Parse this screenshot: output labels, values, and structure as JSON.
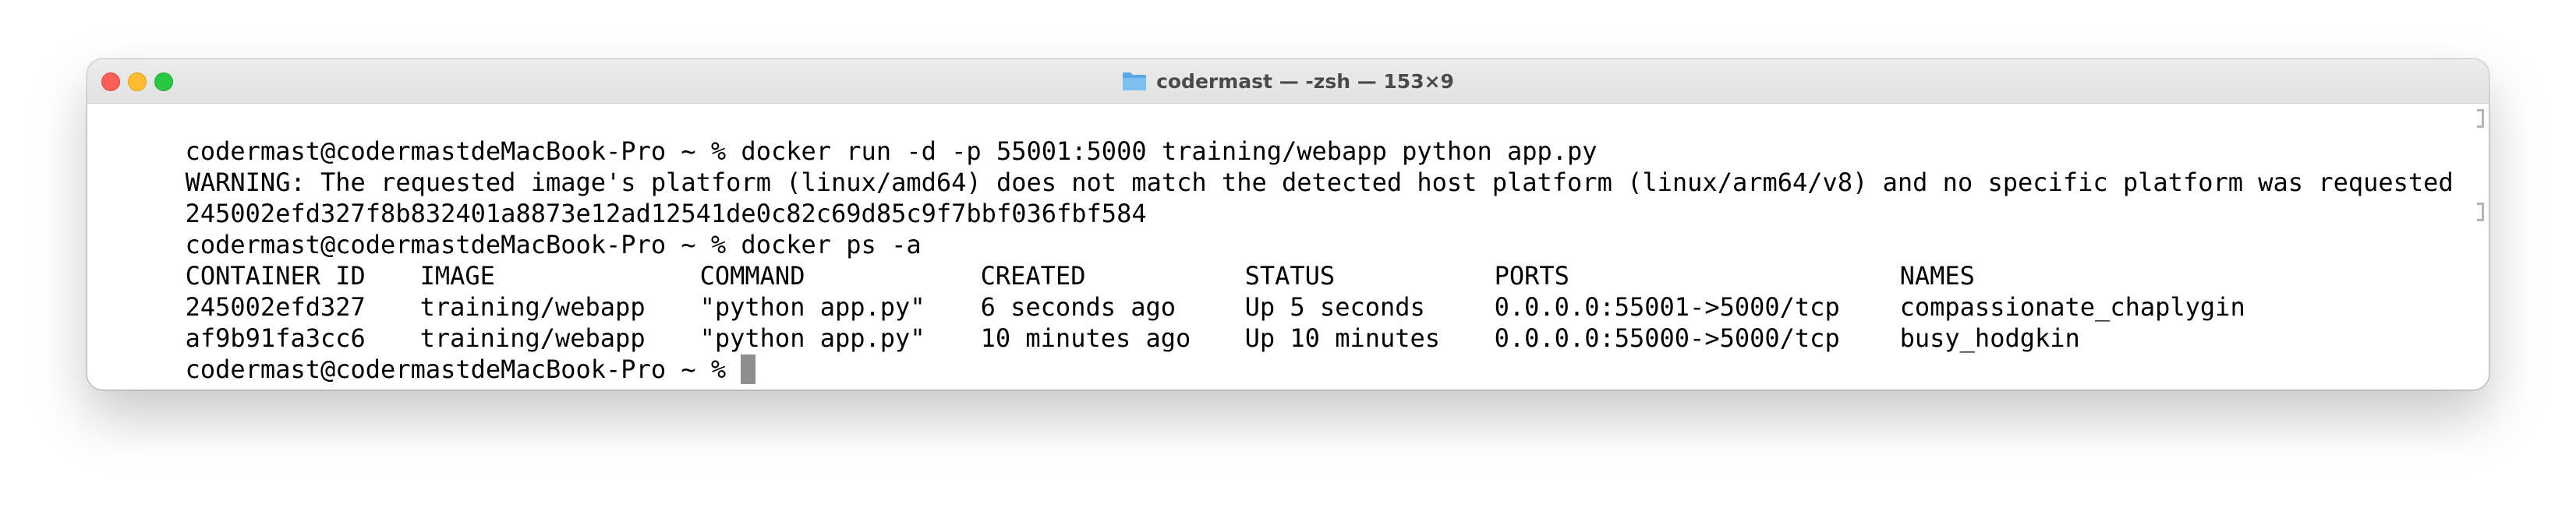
{
  "window": {
    "title": "codermast — -zsh — 153×9",
    "icon": "folder-icon"
  },
  "colors": {
    "close": "#fe5f57",
    "minimize": "#febc2e",
    "zoom": "#28c840",
    "folder": "#5aa9e6",
    "cursor": "#8e8e8e"
  },
  "terminal": {
    "cmd1": "codermast@codermastdeMacBook-Pro ~ % docker run -d -p 55001:5000 training/webapp python app.py",
    "warning": "WARNING: The requested image's platform (linux/amd64) does not match the detected host platform (linux/arm64/v8) and no specific platform was requested",
    "container_hash": "245002efd327f8b832401a8873e12ad12541de0c82c69d85c9f7bbf036fbf584",
    "cmd2": "codermast@codermastdeMacBook-Pro ~ % docker ps -a",
    "table": {
      "headers": [
        "CONTAINER ID",
        "IMAGE",
        "COMMAND",
        "CREATED",
        "STATUS",
        "PORTS",
        "NAMES"
      ],
      "rows": [
        [
          "245002efd327",
          "training/webapp",
          "\"python app.py\"",
          "6 seconds ago",
          "Up 5 seconds",
          "0.0.0.0:55001->5000/tcp",
          "compassionate_chaplygin"
        ],
        [
          "af9b91fa3cc6",
          "training/webapp",
          "\"python app.py\"",
          "10 minutes ago",
          "Up 10 minutes",
          "0.0.0.0:55000->5000/tcp",
          "busy_hodgkin"
        ]
      ]
    },
    "prompt": "codermast@codermastdeMacBook-Pro ~ % "
  }
}
